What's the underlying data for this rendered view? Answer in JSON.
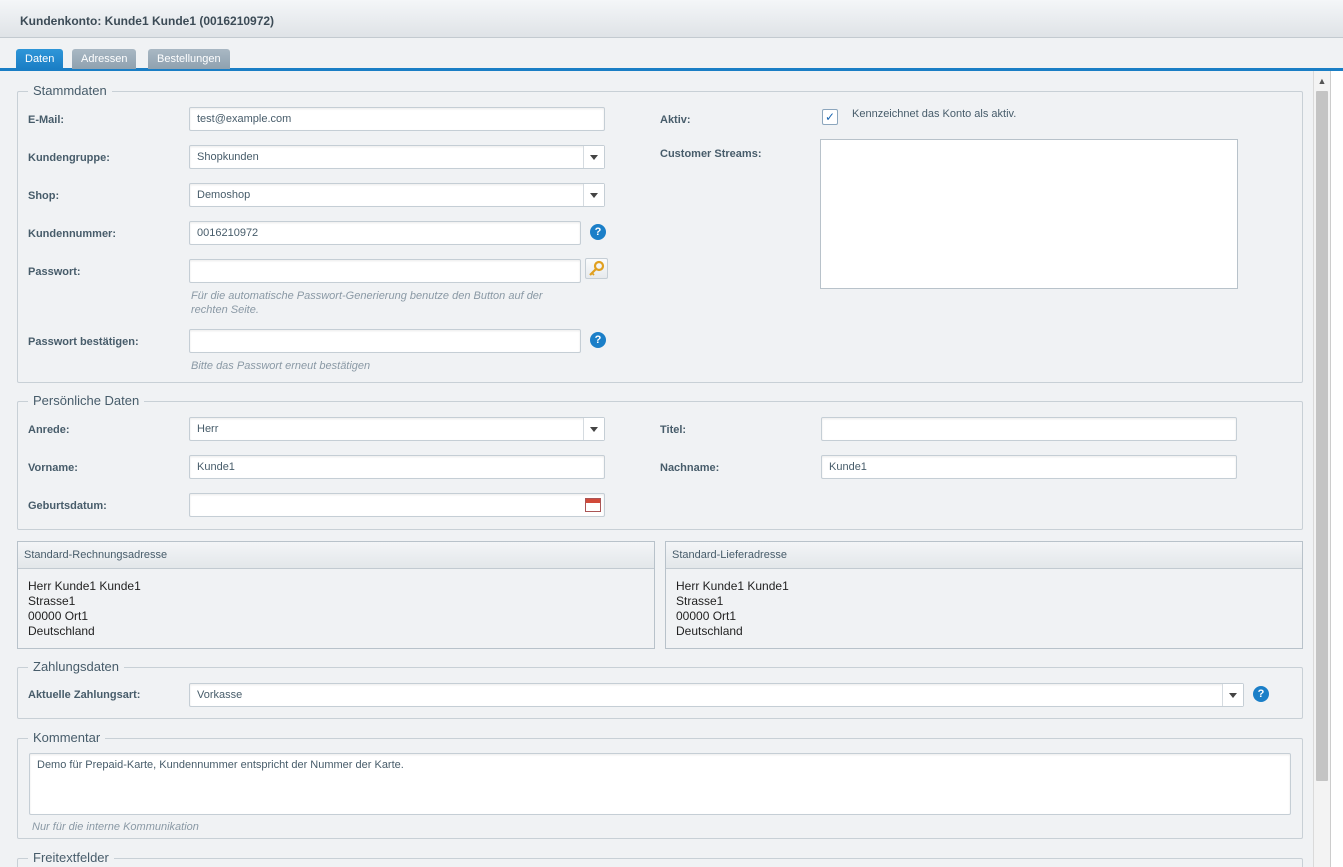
{
  "window": {
    "title": "Kundenkonto: Kunde1 Kunde1 (0016210972)"
  },
  "tabs": [
    {
      "label": "Daten",
      "active": true
    },
    {
      "label": "Adressen",
      "active": false
    },
    {
      "label": "Bestellungen",
      "active": false
    }
  ],
  "stammdaten": {
    "legend": "Stammdaten",
    "email_label": "E-Mail:",
    "email_value": "test@example.com",
    "kundengruppe_label": "Kundengruppe:",
    "kundengruppe_value": "Shopkunden",
    "shop_label": "Shop:",
    "shop_value": "Demoshop",
    "kundennummer_label": "Kundennummer:",
    "kundennummer_value": "0016210972",
    "passwort_label": "Passwort:",
    "passwort_value": "",
    "passwort_hint": "Für die automatische Passwort-Generierung benutze den Button auf der rechten Seite.",
    "passwort_confirm_label": "Passwort bestätigen:",
    "passwort_confirm_value": "",
    "passwort_confirm_hint": "Bitte das Passwort erneut bestätigen",
    "aktiv_label": "Aktiv:",
    "aktiv_checked": true,
    "aktiv_hint": "Kennzeichnet das Konto als aktiv.",
    "customer_streams_label": "Customer Streams:"
  },
  "persoenlich": {
    "legend": "Persönliche Daten",
    "anrede_label": "Anrede:",
    "anrede_value": "Herr",
    "titel_label": "Titel:",
    "titel_value": "",
    "vorname_label": "Vorname:",
    "vorname_value": "Kunde1",
    "nachname_label": "Nachname:",
    "nachname_value": "Kunde1",
    "geburtsdatum_label": "Geburtsdatum:",
    "geburtsdatum_value": ""
  },
  "rechnungsadresse": {
    "title": "Standard-Rechnungsadresse",
    "lines": [
      "Herr Kunde1 Kunde1",
      "Strasse1",
      "00000 Ort1",
      "Deutschland"
    ]
  },
  "lieferadresse": {
    "title": "Standard-Lieferadresse",
    "lines": [
      "Herr Kunde1 Kunde1",
      "Strasse1",
      "00000 Ort1",
      "Deutschland"
    ]
  },
  "zahlungsdaten": {
    "legend": "Zahlungsdaten",
    "zahlungsart_label": "Aktuelle Zahlungsart:",
    "zahlungsart_value": "Vorkasse"
  },
  "kommentar": {
    "legend": "Kommentar",
    "value": "Demo für Prepaid-Karte, Kundennummer entspricht der Nummer der Karte.",
    "hint": "Nur für die interne Kommunikation"
  },
  "freitextfelder": {
    "legend": "Freitextfelder"
  },
  "icons": {
    "help": "?",
    "check": "✓",
    "scroll_up": "▲"
  }
}
